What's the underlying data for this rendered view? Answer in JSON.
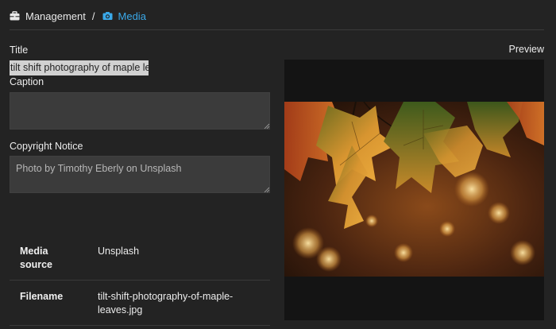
{
  "breadcrumb": {
    "items": [
      {
        "label": "Management",
        "icon": "briefcase-icon"
      },
      {
        "label": "Media",
        "icon": "camera-icon",
        "color": "#3aa8e8"
      }
    ],
    "separator": "/"
  },
  "form": {
    "title_label": "Title",
    "title_value": "tilt shift photography of maple leaves",
    "caption_label": "Caption",
    "caption_value": "",
    "copyright_label": "Copyright Notice",
    "copyright_value": "Photo by Timothy Eberly on Unsplash"
  },
  "meta": {
    "rows": [
      {
        "key_line1": "Media",
        "key_line2": "source",
        "value_line1": "Unsplash",
        "value_line2": ""
      },
      {
        "key_line1": "Filename",
        "key_line2": "",
        "value_line1": "tilt-shift-photography-of-maple-",
        "value_line2": "leaves.jpg"
      }
    ]
  },
  "preview": {
    "label": "Preview"
  }
}
